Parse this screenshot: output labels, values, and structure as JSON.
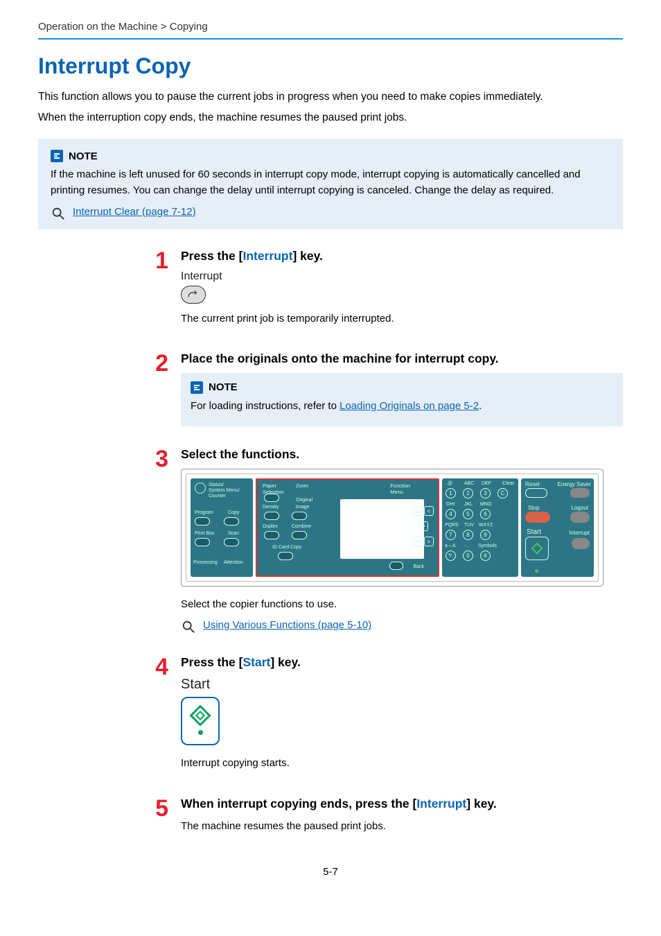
{
  "breadcrumb": "Operation on the Machine > Copying",
  "title": "Interrupt Copy",
  "intro": [
    "This function allows you to pause the current jobs in progress when you need to make copies immediately.",
    "When the interruption copy ends, the machine resumes the paused print jobs."
  ],
  "note": {
    "heading": "NOTE",
    "body": "If the machine is left unused for 60 seconds in interrupt copy mode, interrupt copying is automatically cancelled and printing resumes. You can change the delay until interrupt copying is canceled. Change the delay as required.",
    "ref": "Interrupt Clear (page 7-12)"
  },
  "steps": {
    "s1": {
      "num": "1",
      "title_pre": "Press the [",
      "title_kw": "Interrupt",
      "title_post": "] key.",
      "fig_label": "Interrupt",
      "after": "The current print job is temporarily interrupted."
    },
    "s2": {
      "num": "2",
      "title": "Place the originals onto the machine for interrupt copy.",
      "note_heading": "NOTE",
      "note_pre": "For loading instructions, refer to ",
      "note_link": "Loading Originals on page 5-2",
      "note_post": "."
    },
    "s3": {
      "num": "3",
      "title": "Select the functions.",
      "after": "Select the copier functions to use.",
      "ref": "Using Various Functions (page 5-10)"
    },
    "s4": {
      "num": "4",
      "title_pre": "Press the [",
      "title_kw": "Start",
      "title_post": "] key.",
      "fig_label": "Start",
      "after": "Interrupt copying starts."
    },
    "s5": {
      "num": "5",
      "title_pre": "When interrupt copying ends, press the [",
      "title_kw": "Interrupt",
      "title_post": "] key.",
      "after": "The machine resumes the paused print jobs."
    }
  },
  "panel": {
    "left": {
      "status": "Status/",
      "sysmenu": "System Menu/",
      "counter": "Counter",
      "program": "Program",
      "copy": "Copy",
      "printbox": "Print Box",
      "scan": "Scan",
      "processing": "Processing",
      "attention": "Attention"
    },
    "mid": {
      "paper": "Paper",
      "selection": "Selection",
      "zoom": "Zoom",
      "density": "Density",
      "original": "Original",
      "image": "Image",
      "duplex": "Duplex",
      "combine": "Combine",
      "idcard": "ID Card Copy",
      "function": "Function",
      "menu": "Menu",
      "back": "Back"
    },
    "keys": {
      "clear": "Clear",
      "labels": [
        ".@",
        "ABC",
        "DEF",
        "GHI",
        "JKL",
        "MNO",
        "PQRS",
        "TUV",
        "WXYZ",
        "a⇔A",
        "- .",
        "Symbols"
      ]
    },
    "right": {
      "reset": "Reset",
      "energy": "Energy Saver",
      "stop": "Stop",
      "logout": "Logout",
      "start": "Start",
      "interrupt": "Interrupt"
    }
  },
  "page_num": "5-7"
}
